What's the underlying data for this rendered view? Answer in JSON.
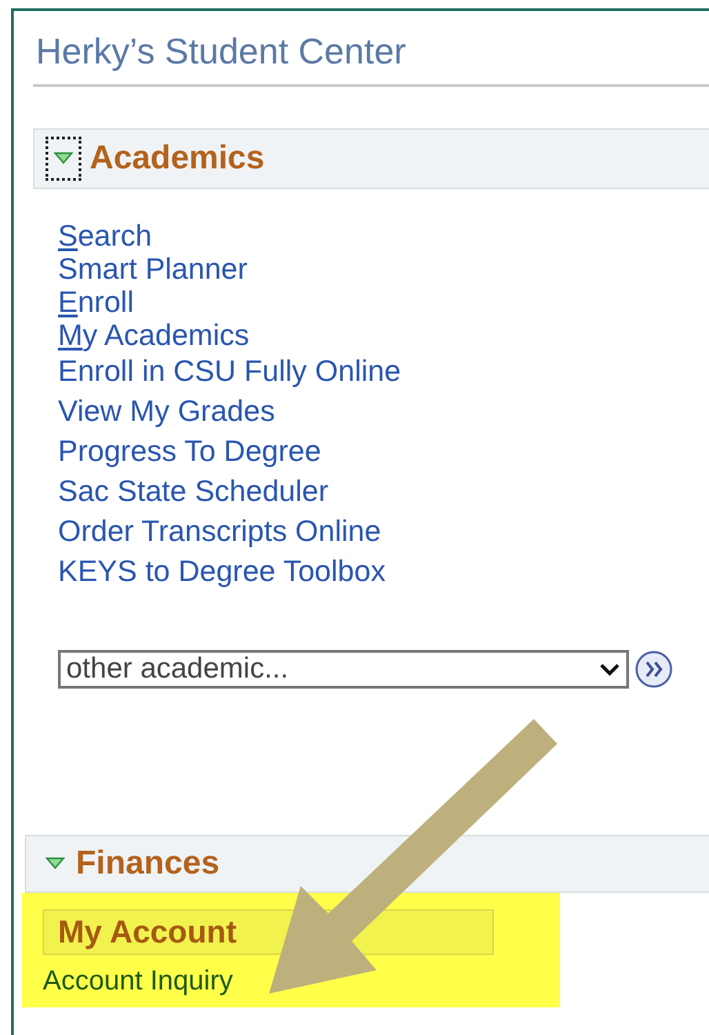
{
  "page": {
    "title": "Herky’s Student Center"
  },
  "sections": [
    {
      "title": "Academics",
      "expanded": true,
      "focused": true,
      "links": [
        {
          "label": "Search",
          "accesskey": true,
          "compact": true
        },
        {
          "label": "Smart Planner",
          "accesskey": false,
          "compact": true
        },
        {
          "label": "Enroll",
          "accesskey": true,
          "compact": true
        },
        {
          "label": "My Academics",
          "accesskey": true,
          "compact": true
        },
        {
          "label": "Enroll in CSU Fully Online",
          "accesskey": false,
          "compact": false
        },
        {
          "label": "View My Grades",
          "accesskey": false,
          "compact": false
        },
        {
          "label": "Progress To Degree",
          "accesskey": false,
          "compact": false
        },
        {
          "label": "Sac State Scheduler",
          "accesskey": false,
          "compact": false
        },
        {
          "label": "Order Transcripts Online",
          "accesskey": false,
          "compact": false
        },
        {
          "label": "KEYS to Degree Toolbox",
          "accesskey": false,
          "compact": false
        }
      ],
      "dropdown": {
        "value": "other academic..."
      }
    },
    {
      "title": "Finances",
      "expanded": true,
      "focused": false,
      "subheading": "My Account",
      "links": [
        {
          "label": "Account Inquiry",
          "accesskey": false,
          "compact": false
        }
      ]
    }
  ]
}
